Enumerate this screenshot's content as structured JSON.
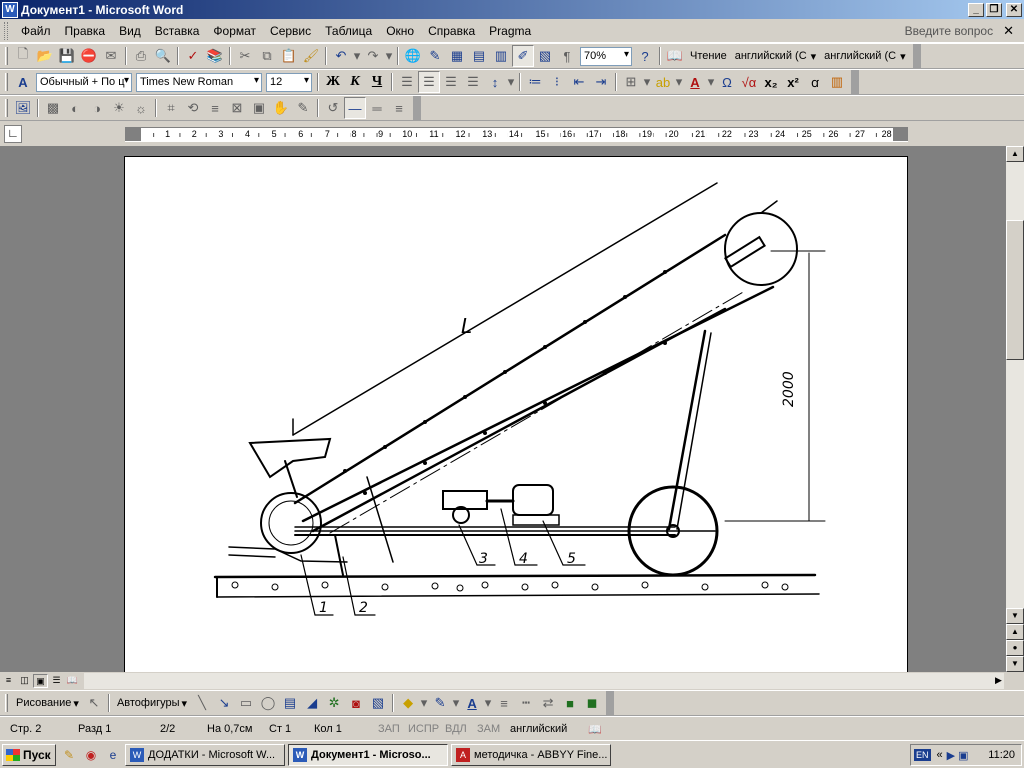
{
  "window": {
    "title": "Документ1 - Microsoft Word",
    "app_icon": "W"
  },
  "menu": {
    "items": [
      "Файл",
      "Правка",
      "Вид",
      "Вставка",
      "Формат",
      "Сервис",
      "Таблица",
      "Окно",
      "Справка",
      "Pragma"
    ],
    "help_placeholder": "Введите вопрос"
  },
  "standard_toolbar": {
    "zoom": "70%",
    "reading_label": "Чтение",
    "lang1": "английский (С",
    "lang2": "английский (С"
  },
  "format_toolbar": {
    "style": "Обычный + По ц",
    "font": "Times New Roman",
    "size": "12",
    "bold": "Ж",
    "italic": "К",
    "underline": "Ч"
  },
  "ruler": {
    "numbers": [
      "1",
      "2",
      "3",
      "4",
      "5",
      "6",
      "7",
      "8",
      "9",
      "10",
      "11",
      "12",
      "13",
      "14",
      "15",
      "16",
      "17",
      "18",
      "19",
      "20",
      "21",
      "22",
      "23",
      "24",
      "25",
      "26",
      "27",
      "28"
    ]
  },
  "drawing": {
    "labels": {
      "length": "L",
      "height": "2000",
      "n1": "1",
      "n2": "2",
      "n3": "3",
      "n4": "4",
      "n5": "5"
    }
  },
  "drawing_toolbar": {
    "draw_menu": "Рисование",
    "autoshapes": "Автофигуры"
  },
  "status": {
    "page": "Стр. 2",
    "section": "Разд 1",
    "pages": "2/2",
    "at": "На 0,7см",
    "line": "Ст 1",
    "col": "Кол 1",
    "rec": "ЗАП",
    "trk": "ИСПР",
    "ext": "ВДЛ",
    "ovr": "ЗАМ",
    "lang": "английский"
  },
  "taskbar": {
    "start": "Пуск",
    "tasks": [
      "ДОДАТКИ - Microsoft W...",
      "Документ1 - Microso...",
      "методичка - ABBYY Fine..."
    ],
    "tray_lang": "EN",
    "clock": "11:20"
  },
  "colors": {
    "title_start": "#0a246a",
    "title_end": "#a6caf0",
    "chrome": "#d4d0c8",
    "doc_bg": "#808080"
  }
}
